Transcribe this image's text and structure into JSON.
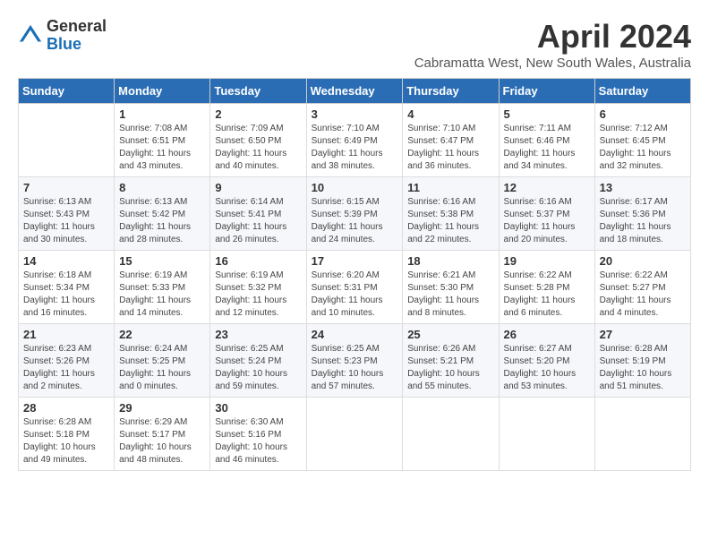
{
  "logo": {
    "general": "General",
    "blue": "Blue"
  },
  "title": "April 2024",
  "location": "Cabramatta West, New South Wales, Australia",
  "days_of_week": [
    "Sunday",
    "Monday",
    "Tuesday",
    "Wednesday",
    "Thursday",
    "Friday",
    "Saturday"
  ],
  "weeks": [
    [
      {
        "day": "",
        "sunrise": "",
        "sunset": "",
        "daylight": ""
      },
      {
        "day": "1",
        "sunrise": "Sunrise: 7:08 AM",
        "sunset": "Sunset: 6:51 PM",
        "daylight": "Daylight: 11 hours and 43 minutes."
      },
      {
        "day": "2",
        "sunrise": "Sunrise: 7:09 AM",
        "sunset": "Sunset: 6:50 PM",
        "daylight": "Daylight: 11 hours and 40 minutes."
      },
      {
        "day": "3",
        "sunrise": "Sunrise: 7:10 AM",
        "sunset": "Sunset: 6:49 PM",
        "daylight": "Daylight: 11 hours and 38 minutes."
      },
      {
        "day": "4",
        "sunrise": "Sunrise: 7:10 AM",
        "sunset": "Sunset: 6:47 PM",
        "daylight": "Daylight: 11 hours and 36 minutes."
      },
      {
        "day": "5",
        "sunrise": "Sunrise: 7:11 AM",
        "sunset": "Sunset: 6:46 PM",
        "daylight": "Daylight: 11 hours and 34 minutes."
      },
      {
        "day": "6",
        "sunrise": "Sunrise: 7:12 AM",
        "sunset": "Sunset: 6:45 PM",
        "daylight": "Daylight: 11 hours and 32 minutes."
      }
    ],
    [
      {
        "day": "7",
        "sunrise": "Sunrise: 6:13 AM",
        "sunset": "Sunset: 5:43 PM",
        "daylight": "Daylight: 11 hours and 30 minutes."
      },
      {
        "day": "8",
        "sunrise": "Sunrise: 6:13 AM",
        "sunset": "Sunset: 5:42 PM",
        "daylight": "Daylight: 11 hours and 28 minutes."
      },
      {
        "day": "9",
        "sunrise": "Sunrise: 6:14 AM",
        "sunset": "Sunset: 5:41 PM",
        "daylight": "Daylight: 11 hours and 26 minutes."
      },
      {
        "day": "10",
        "sunrise": "Sunrise: 6:15 AM",
        "sunset": "Sunset: 5:39 PM",
        "daylight": "Daylight: 11 hours and 24 minutes."
      },
      {
        "day": "11",
        "sunrise": "Sunrise: 6:16 AM",
        "sunset": "Sunset: 5:38 PM",
        "daylight": "Daylight: 11 hours and 22 minutes."
      },
      {
        "day": "12",
        "sunrise": "Sunrise: 6:16 AM",
        "sunset": "Sunset: 5:37 PM",
        "daylight": "Daylight: 11 hours and 20 minutes."
      },
      {
        "day": "13",
        "sunrise": "Sunrise: 6:17 AM",
        "sunset": "Sunset: 5:36 PM",
        "daylight": "Daylight: 11 hours and 18 minutes."
      }
    ],
    [
      {
        "day": "14",
        "sunrise": "Sunrise: 6:18 AM",
        "sunset": "Sunset: 5:34 PM",
        "daylight": "Daylight: 11 hours and 16 minutes."
      },
      {
        "day": "15",
        "sunrise": "Sunrise: 6:19 AM",
        "sunset": "Sunset: 5:33 PM",
        "daylight": "Daylight: 11 hours and 14 minutes."
      },
      {
        "day": "16",
        "sunrise": "Sunrise: 6:19 AM",
        "sunset": "Sunset: 5:32 PM",
        "daylight": "Daylight: 11 hours and 12 minutes."
      },
      {
        "day": "17",
        "sunrise": "Sunrise: 6:20 AM",
        "sunset": "Sunset: 5:31 PM",
        "daylight": "Daylight: 11 hours and 10 minutes."
      },
      {
        "day": "18",
        "sunrise": "Sunrise: 6:21 AM",
        "sunset": "Sunset: 5:30 PM",
        "daylight": "Daylight: 11 hours and 8 minutes."
      },
      {
        "day": "19",
        "sunrise": "Sunrise: 6:22 AM",
        "sunset": "Sunset: 5:28 PM",
        "daylight": "Daylight: 11 hours and 6 minutes."
      },
      {
        "day": "20",
        "sunrise": "Sunrise: 6:22 AM",
        "sunset": "Sunset: 5:27 PM",
        "daylight": "Daylight: 11 hours and 4 minutes."
      }
    ],
    [
      {
        "day": "21",
        "sunrise": "Sunrise: 6:23 AM",
        "sunset": "Sunset: 5:26 PM",
        "daylight": "Daylight: 11 hours and 2 minutes."
      },
      {
        "day": "22",
        "sunrise": "Sunrise: 6:24 AM",
        "sunset": "Sunset: 5:25 PM",
        "daylight": "Daylight: 11 hours and 0 minutes."
      },
      {
        "day": "23",
        "sunrise": "Sunrise: 6:25 AM",
        "sunset": "Sunset: 5:24 PM",
        "daylight": "Daylight: 10 hours and 59 minutes."
      },
      {
        "day": "24",
        "sunrise": "Sunrise: 6:25 AM",
        "sunset": "Sunset: 5:23 PM",
        "daylight": "Daylight: 10 hours and 57 minutes."
      },
      {
        "day": "25",
        "sunrise": "Sunrise: 6:26 AM",
        "sunset": "Sunset: 5:21 PM",
        "daylight": "Daylight: 10 hours and 55 minutes."
      },
      {
        "day": "26",
        "sunrise": "Sunrise: 6:27 AM",
        "sunset": "Sunset: 5:20 PM",
        "daylight": "Daylight: 10 hours and 53 minutes."
      },
      {
        "day": "27",
        "sunrise": "Sunrise: 6:28 AM",
        "sunset": "Sunset: 5:19 PM",
        "daylight": "Daylight: 10 hours and 51 minutes."
      }
    ],
    [
      {
        "day": "28",
        "sunrise": "Sunrise: 6:28 AM",
        "sunset": "Sunset: 5:18 PM",
        "daylight": "Daylight: 10 hours and 49 minutes."
      },
      {
        "day": "29",
        "sunrise": "Sunrise: 6:29 AM",
        "sunset": "Sunset: 5:17 PM",
        "daylight": "Daylight: 10 hours and 48 minutes."
      },
      {
        "day": "30",
        "sunrise": "Sunrise: 6:30 AM",
        "sunset": "Sunset: 5:16 PM",
        "daylight": "Daylight: 10 hours and 46 minutes."
      },
      {
        "day": "",
        "sunrise": "",
        "sunset": "",
        "daylight": ""
      },
      {
        "day": "",
        "sunrise": "",
        "sunset": "",
        "daylight": ""
      },
      {
        "day": "",
        "sunrise": "",
        "sunset": "",
        "daylight": ""
      },
      {
        "day": "",
        "sunrise": "",
        "sunset": "",
        "daylight": ""
      }
    ]
  ]
}
